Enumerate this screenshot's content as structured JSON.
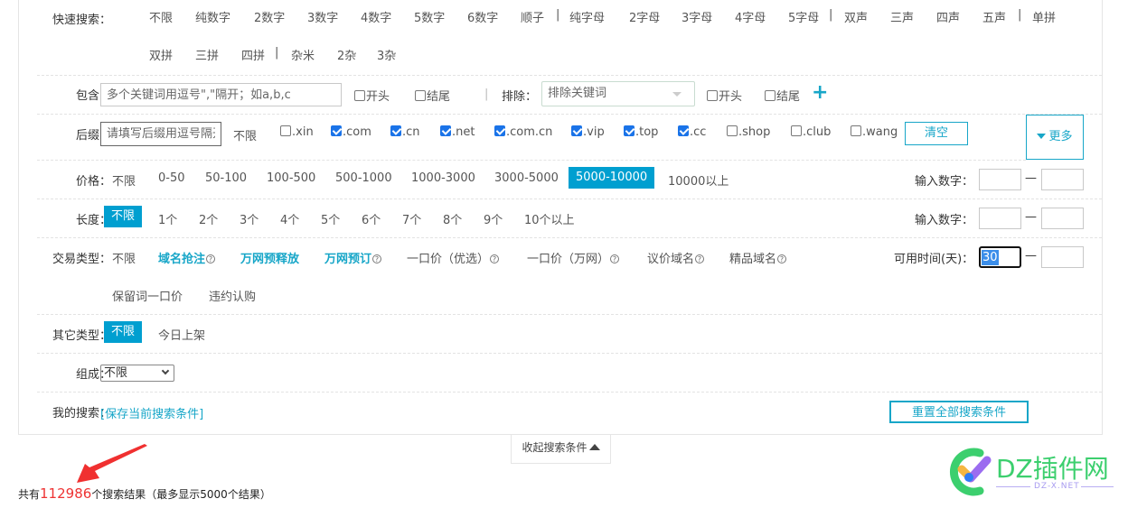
{
  "quick_search": {
    "label": "快速搜索：",
    "row1": [
      "不限",
      "纯数字",
      "2数字",
      "3数字",
      "4数字",
      "5数字",
      "6数字",
      "顺子",
      "纯字母",
      "2字母",
      "3字母",
      "4字母",
      "5字母",
      "双声",
      "三声",
      "四声",
      "五声",
      "单拼"
    ],
    "row2": [
      "双拼",
      "三拼",
      "四拼",
      "杂米",
      "2杂",
      "3杂"
    ],
    "separator": "|"
  },
  "include": {
    "label": "包含：",
    "placeholder": "多个关键词用逗号\",\"隔开；如a,b,c",
    "start_label": "开头",
    "end_label": "结尾",
    "exclude_label": "排除：",
    "exclude_placeholder": "排除关键词",
    "exclude_start_label": "开头",
    "exclude_end_label": "结尾",
    "add_icon": "plus-icon"
  },
  "suffix": {
    "label": "后缀：",
    "placeholder": "请填写后缀用逗号隔开",
    "unlimited": "不限",
    "options": [
      {
        "label": ".xin",
        "checked": false
      },
      {
        "label": ".com",
        "checked": true
      },
      {
        "label": ".cn",
        "checked": true
      },
      {
        "label": ".net",
        "checked": true
      },
      {
        "label": ".com.cn",
        "checked": true
      },
      {
        "label": ".vip",
        "checked": true
      },
      {
        "label": ".top",
        "checked": true
      },
      {
        "label": ".cc",
        "checked": true
      },
      {
        "label": ".shop",
        "checked": false
      },
      {
        "label": ".club",
        "checked": false
      },
      {
        "label": ".wang",
        "checked": false
      }
    ],
    "clear_label": "清空",
    "more_label": "更多"
  },
  "price": {
    "label": "价格：",
    "options": [
      "不限",
      "0-50",
      "50-100",
      "100-500",
      "500-1000",
      "1000-3000",
      "3000-5000",
      "5000-10000",
      "10000以上"
    ],
    "selected": "5000-10000",
    "input_label": "输入数字：",
    "dash": "—"
  },
  "length": {
    "label": "长度：",
    "options": [
      "不限",
      "1个",
      "2个",
      "3个",
      "4个",
      "5个",
      "6个",
      "7个",
      "8个",
      "9个",
      "10个以上"
    ],
    "selected": "不限",
    "input_label": "输入数字：",
    "dash": "—"
  },
  "trade_type": {
    "label": "交易类型：",
    "options": [
      {
        "label": "不限",
        "highlight": false,
        "help": false
      },
      {
        "label": "域名抢注",
        "highlight": true,
        "help": true
      },
      {
        "label": "万网预释放",
        "highlight": true,
        "help": false
      },
      {
        "label": "万网预订",
        "highlight": true,
        "help": true
      },
      {
        "label": "一口价（优选）",
        "highlight": false,
        "help": true
      },
      {
        "label": "一口价（万网）",
        "highlight": false,
        "help": true
      },
      {
        "label": "议价域名",
        "highlight": false,
        "help": true
      },
      {
        "label": "精品域名",
        "highlight": false,
        "help": true
      }
    ],
    "row2": [
      "保留词一口价",
      "违约认购"
    ],
    "help_glyph": "?",
    "days_label": "可用时间(天)：",
    "days_value": "30",
    "dash": "—"
  },
  "other_type": {
    "label": "其它类型：",
    "options": [
      "不限",
      "今日上架"
    ],
    "selected": "不限"
  },
  "composition": {
    "label": "组成：",
    "selected": "不限"
  },
  "my_search": {
    "label": "我的搜索：",
    "save_link": "[保存当前搜索条件]",
    "reset_label": "重置全部搜索条件"
  },
  "collapse_label": "收起搜索条件",
  "result": {
    "prefix": "共有",
    "count": "112986",
    "suffix": "个搜索结果（最多显示5000个结果）"
  },
  "watermark": {
    "title": "DZ插件网",
    "subtitle": "DZ-X.NET"
  },
  "colors": {
    "accent": "#009fd0",
    "link": "#17a6c8",
    "count_red": "#e33333",
    "checkbox": "#1a73e8"
  }
}
